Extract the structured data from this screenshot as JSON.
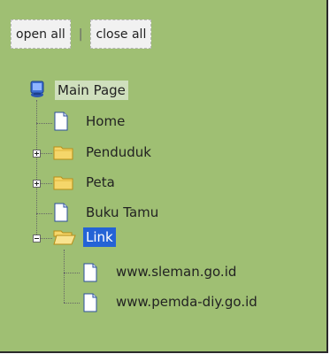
{
  "toolbar": {
    "open_all": "open all",
    "separator": "|",
    "close_all": "close all"
  },
  "tree": {
    "root": {
      "label": "Main Page",
      "icon": "globe-computer-icon"
    },
    "items": [
      {
        "label": "Home",
        "icon": "page-icon",
        "type": "page"
      },
      {
        "label": "Penduduk",
        "icon": "folder-icon",
        "type": "folder",
        "expanded": false
      },
      {
        "label": "Peta",
        "icon": "folder-icon",
        "type": "folder",
        "expanded": false
      },
      {
        "label": "Buku Tamu",
        "icon": "page-icon",
        "type": "page"
      },
      {
        "label": "Link",
        "icon": "folder-open-icon",
        "type": "folder",
        "expanded": true,
        "selected": true,
        "children": [
          {
            "label": "www.sleman.go.id",
            "icon": "page-icon"
          },
          {
            "label": "www.pemda-diy.go.id",
            "icon": "page-icon"
          }
        ]
      }
    ]
  },
  "colors": {
    "panel_bg": "#9fbf73",
    "selected_bg": "#2463d6",
    "root_highlight": "#cfdfbd"
  }
}
